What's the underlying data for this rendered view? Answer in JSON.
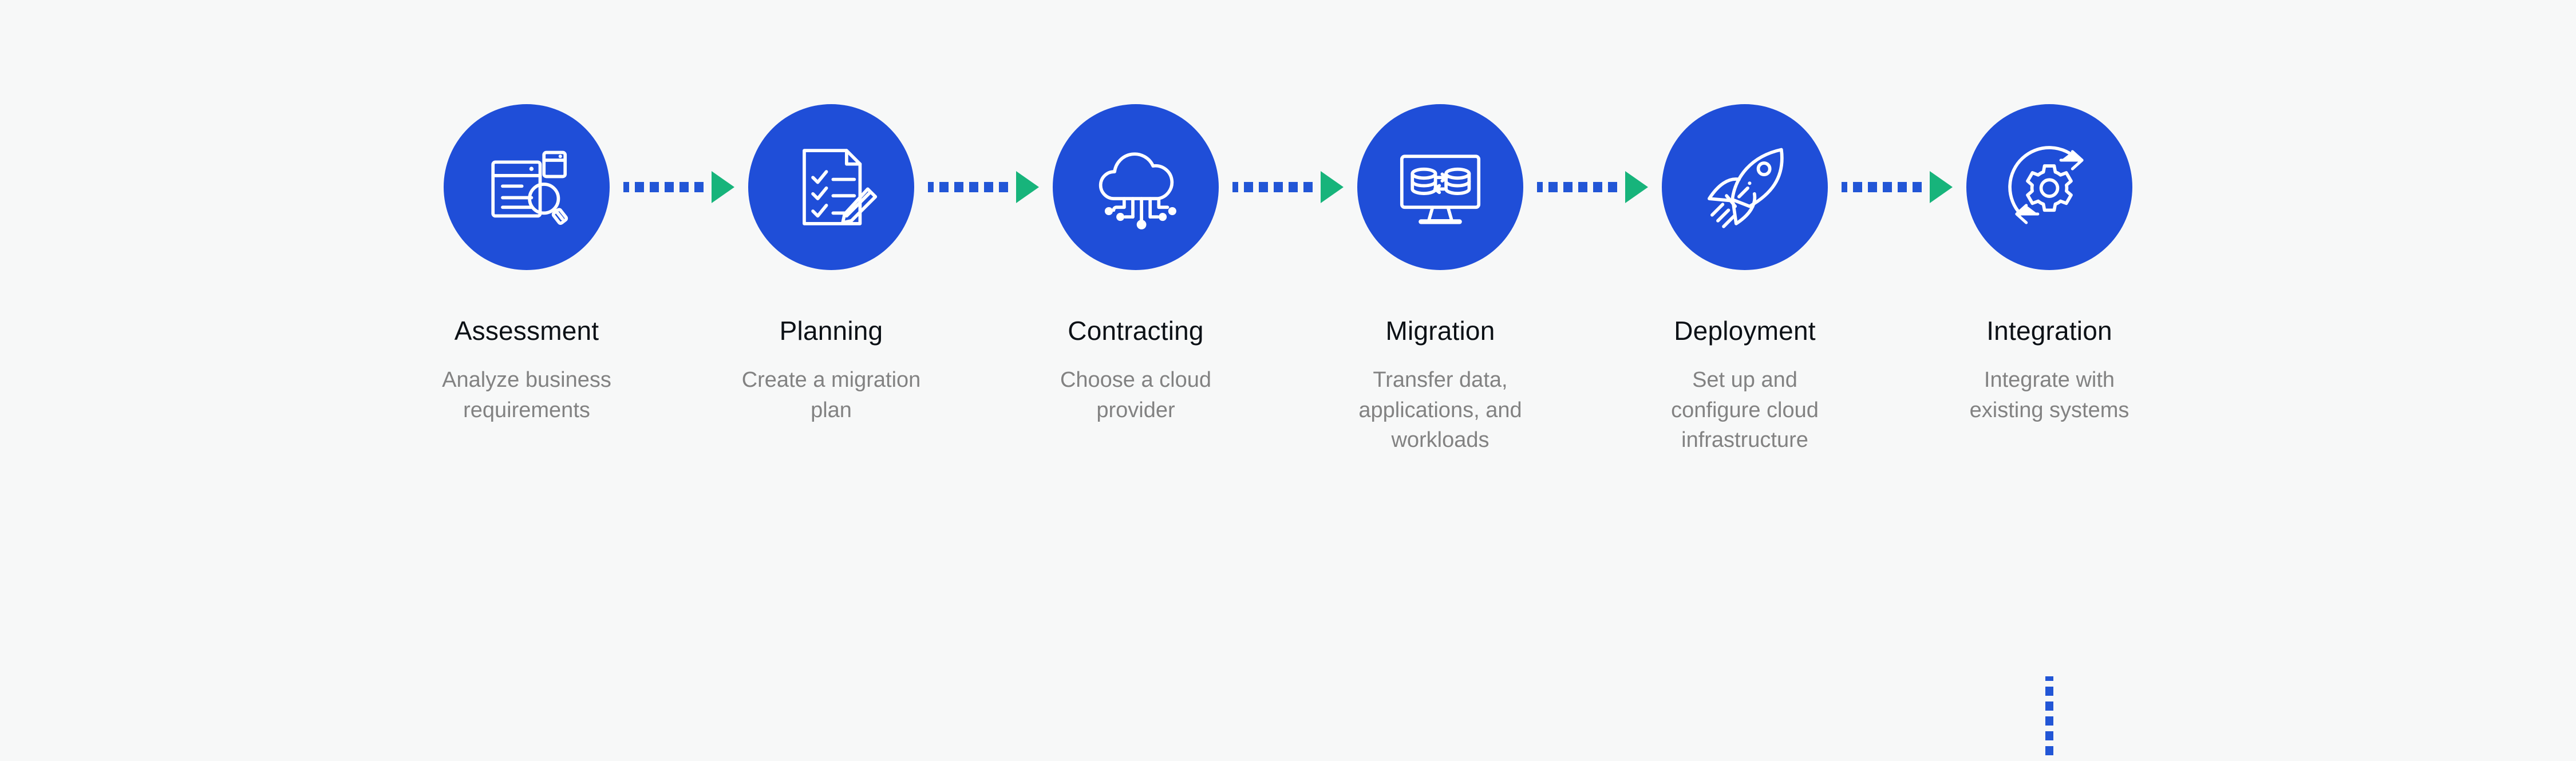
{
  "colors": {
    "background": "#f7f8f8",
    "circle_blue": "#1f4ed8",
    "dash_blue": "#2256d6",
    "arrow_green": "#17b47b",
    "title_text": "#0c1116",
    "desc_text": "#828282",
    "icon_stroke": "#ffffff"
  },
  "diagram": {
    "type": "process-flow",
    "orientation": "horizontal",
    "step_count": 6,
    "connector_style": "dotted-line-with-green-arrowhead",
    "trailing_connector": "vertical-dotted-line"
  },
  "steps": [
    {
      "index": 1,
      "title": "Assessment",
      "description": "Analyze business requirements",
      "icon": "document-magnifier-icon"
    },
    {
      "index": 2,
      "title": "Planning",
      "description": "Create a migration plan",
      "icon": "checklist-pencil-icon"
    },
    {
      "index": 3,
      "title": "Contracting",
      "description": "Choose a cloud provider",
      "icon": "cloud-network-icon"
    },
    {
      "index": 4,
      "title": "Migration",
      "description": "Transfer data, applications, and workloads",
      "icon": "monitor-database-transfer-icon"
    },
    {
      "index": 5,
      "title": "Deployment",
      "description": "Set up and configure cloud infrastructure",
      "icon": "rocket-icon"
    },
    {
      "index": 6,
      "title": "Integration",
      "description": "Integrate with existing systems",
      "icon": "gear-cycle-icon"
    }
  ],
  "connectors": [
    {
      "from": "Assessment",
      "to": "Planning",
      "icon": "dotted-arrow-right-icon"
    },
    {
      "from": "Planning",
      "to": "Contracting",
      "icon": "dotted-arrow-right-icon"
    },
    {
      "from": "Contracting",
      "to": "Migration",
      "icon": "dotted-arrow-right-icon"
    },
    {
      "from": "Migration",
      "to": "Deployment",
      "icon": "dotted-arrow-right-icon"
    },
    {
      "from": "Deployment",
      "to": "Integration",
      "icon": "dotted-arrow-right-icon"
    }
  ]
}
